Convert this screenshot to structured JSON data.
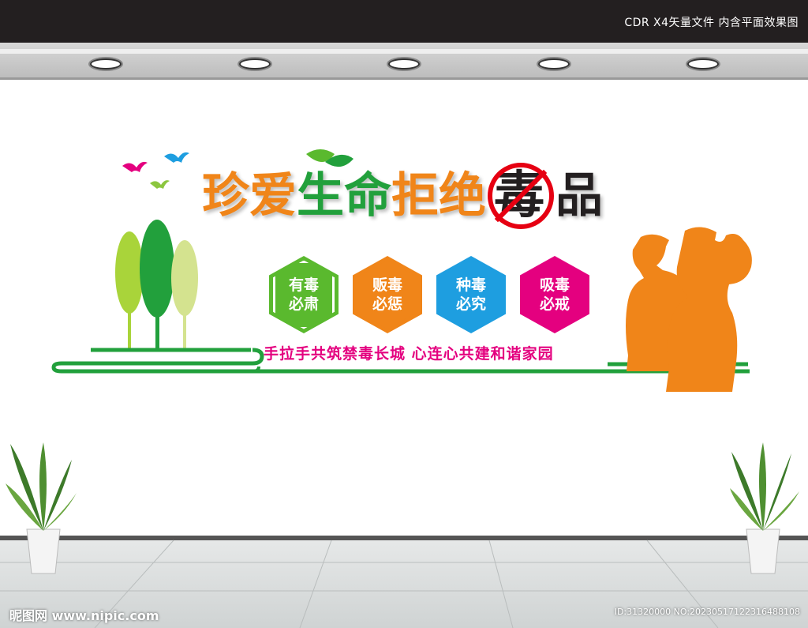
{
  "header": {
    "caption": "CDR X4矢量文件  内含平面效果图"
  },
  "title": {
    "part1": "珍爱",
    "part2": "生命",
    "part3": "拒绝",
    "forbidden_char": "毒",
    "part4": "品"
  },
  "hexagons": [
    {
      "line1": "有毒",
      "line2": "必肃",
      "color": "#5ab92e"
    },
    {
      "line1": "贩毒",
      "line2": "必惩",
      "color": "#f08519"
    },
    {
      "line1": "种毒",
      "line2": "必究",
      "color": "#1e9ee0"
    },
    {
      "line1": "吸毒",
      "line2": "必戒",
      "color": "#e4007f"
    }
  ],
  "slogan": "手拉手共筑禁毒长城  心连心共建和谐家园",
  "watermark": {
    "site": "昵图网 www.nipic.com",
    "id": "ID:31320000 NO:20230517122316488108"
  },
  "colors": {
    "orange": "#f08519",
    "green": "#22a03c",
    "light_green": "#a9d43a",
    "pale_green": "#d4e38f",
    "magenta": "#e4007f",
    "blue": "#1e9ee0",
    "red": "#e60012"
  }
}
